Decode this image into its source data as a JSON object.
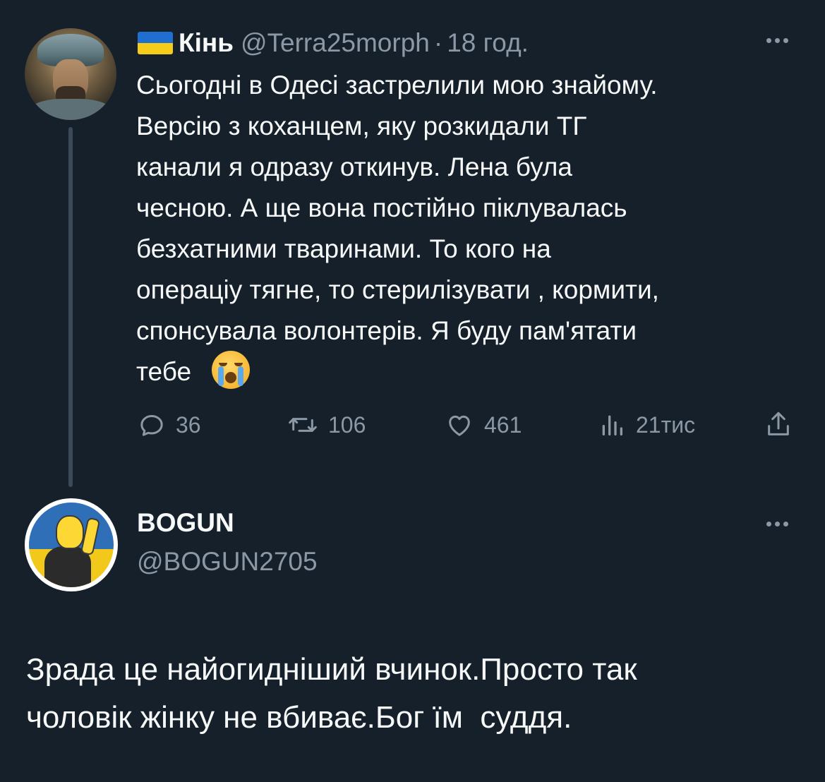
{
  "parent_tweet": {
    "author": {
      "flag_icon": "ukraine-flag-icon",
      "name": "Кінь",
      "handle": "@Terra25morph",
      "separator": "·",
      "time": "18 год."
    },
    "text": "Сьогодні в Одесі застрелили мою знайому.\nВерсію з коханцем, яку розкидали ТГ\nканали я одразу откинув. Лена була\nчесною. А ще вона постійно піклувалась\nбезхатними тваринами. То кого на\nопераціу тягне, то стерилізувати , кормити,\nспонсувала волонтерів. Я буду пам'ятати\nтебе",
    "emoji": "loudly-crying-face-emoji",
    "actions": {
      "replies": "36",
      "retweets": "106",
      "likes": "461",
      "views": "21тис"
    }
  },
  "reply_tweet": {
    "author": {
      "name": "BOGUN",
      "handle": "@BOGUN2705"
    },
    "text": "Зрада це найогидніший вчинок.Просто так\nчоловік жінку не вбиває.Бог їм  суддя."
  },
  "colors": {
    "background": "#15202b",
    "text_primary": "#f7f9f9",
    "text_secondary": "#8b98a5",
    "thread_line": "#3c4a57"
  }
}
